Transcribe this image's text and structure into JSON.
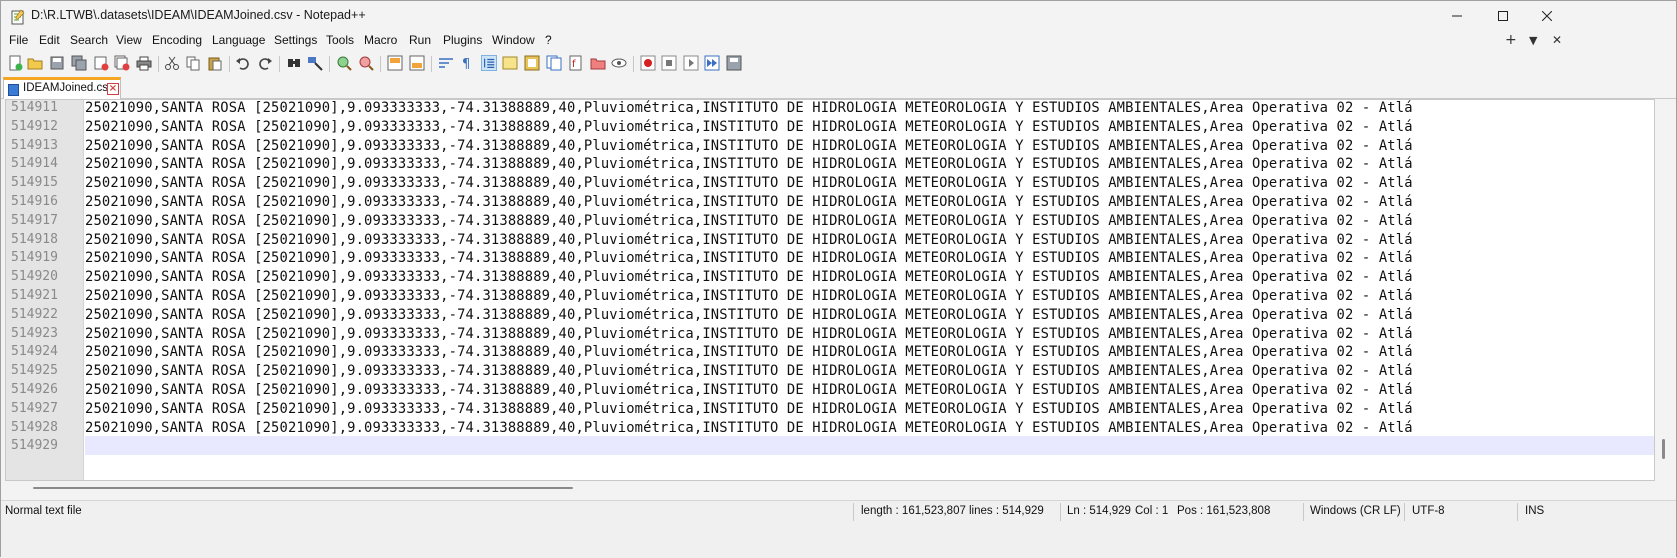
{
  "window": {
    "title": "D:\\R.LTWB\\.datasets\\IDEAM\\IDEAMJoined.csv - Notepad++"
  },
  "menu": [
    "File",
    "Edit",
    "Search",
    "View",
    "Encoding",
    "Language",
    "Settings",
    "Tools",
    "Macro",
    "Run",
    "Plugins",
    "Window",
    "?"
  ],
  "menu_right": {
    "plus": "+",
    "down": "▼",
    "close": "✕"
  },
  "tab": {
    "label": "IDEAMJoined.csv"
  },
  "editor": {
    "lines": [
      {
        "num": "514911",
        "text": "25021090,SANTA ROSA [25021090],9.093333333,-74.31388889,40,Pluviométrica,INSTITUTO DE HIDROLOGIA METEOROLOGIA Y ESTUDIOS AMBIENTALES,Area Operativa 02 - Atlá"
      },
      {
        "num": "514912",
        "text": "25021090,SANTA ROSA [25021090],9.093333333,-74.31388889,40,Pluviométrica,INSTITUTO DE HIDROLOGIA METEOROLOGIA Y ESTUDIOS AMBIENTALES,Area Operativa 02 - Atlá"
      },
      {
        "num": "514913",
        "text": "25021090,SANTA ROSA [25021090],9.093333333,-74.31388889,40,Pluviométrica,INSTITUTO DE HIDROLOGIA METEOROLOGIA Y ESTUDIOS AMBIENTALES,Area Operativa 02 - Atlá"
      },
      {
        "num": "514914",
        "text": "25021090,SANTA ROSA [25021090],9.093333333,-74.31388889,40,Pluviométrica,INSTITUTO DE HIDROLOGIA METEOROLOGIA Y ESTUDIOS AMBIENTALES,Area Operativa 02 - Atlá"
      },
      {
        "num": "514915",
        "text": "25021090,SANTA ROSA [25021090],9.093333333,-74.31388889,40,Pluviométrica,INSTITUTO DE HIDROLOGIA METEOROLOGIA Y ESTUDIOS AMBIENTALES,Area Operativa 02 - Atlá"
      },
      {
        "num": "514916",
        "text": "25021090,SANTA ROSA [25021090],9.093333333,-74.31388889,40,Pluviométrica,INSTITUTO DE HIDROLOGIA METEOROLOGIA Y ESTUDIOS AMBIENTALES,Area Operativa 02 - Atlá"
      },
      {
        "num": "514917",
        "text": "25021090,SANTA ROSA [25021090],9.093333333,-74.31388889,40,Pluviométrica,INSTITUTO DE HIDROLOGIA METEOROLOGIA Y ESTUDIOS AMBIENTALES,Area Operativa 02 - Atlá"
      },
      {
        "num": "514918",
        "text": "25021090,SANTA ROSA [25021090],9.093333333,-74.31388889,40,Pluviométrica,INSTITUTO DE HIDROLOGIA METEOROLOGIA Y ESTUDIOS AMBIENTALES,Area Operativa 02 - Atlá"
      },
      {
        "num": "514919",
        "text": "25021090,SANTA ROSA [25021090],9.093333333,-74.31388889,40,Pluviométrica,INSTITUTO DE HIDROLOGIA METEOROLOGIA Y ESTUDIOS AMBIENTALES,Area Operativa 02 - Atlá"
      },
      {
        "num": "514920",
        "text": "25021090,SANTA ROSA [25021090],9.093333333,-74.31388889,40,Pluviométrica,INSTITUTO DE HIDROLOGIA METEOROLOGIA Y ESTUDIOS AMBIENTALES,Area Operativa 02 - Atlá"
      },
      {
        "num": "514921",
        "text": "25021090,SANTA ROSA [25021090],9.093333333,-74.31388889,40,Pluviométrica,INSTITUTO DE HIDROLOGIA METEOROLOGIA Y ESTUDIOS AMBIENTALES,Area Operativa 02 - Atlá"
      },
      {
        "num": "514922",
        "text": "25021090,SANTA ROSA [25021090],9.093333333,-74.31388889,40,Pluviométrica,INSTITUTO DE HIDROLOGIA METEOROLOGIA Y ESTUDIOS AMBIENTALES,Area Operativa 02 - Atlá"
      },
      {
        "num": "514923",
        "text": "25021090,SANTA ROSA [25021090],9.093333333,-74.31388889,40,Pluviométrica,INSTITUTO DE HIDROLOGIA METEOROLOGIA Y ESTUDIOS AMBIENTALES,Area Operativa 02 - Atlá"
      },
      {
        "num": "514924",
        "text": "25021090,SANTA ROSA [25021090],9.093333333,-74.31388889,40,Pluviométrica,INSTITUTO DE HIDROLOGIA METEOROLOGIA Y ESTUDIOS AMBIENTALES,Area Operativa 02 - Atlá"
      },
      {
        "num": "514925",
        "text": "25021090,SANTA ROSA [25021090],9.093333333,-74.31388889,40,Pluviométrica,INSTITUTO DE HIDROLOGIA METEOROLOGIA Y ESTUDIOS AMBIENTALES,Area Operativa 02 - Atlá"
      },
      {
        "num": "514926",
        "text": "25021090,SANTA ROSA [25021090],9.093333333,-74.31388889,40,Pluviométrica,INSTITUTO DE HIDROLOGIA METEOROLOGIA Y ESTUDIOS AMBIENTALES,Area Operativa 02 - Atlá"
      },
      {
        "num": "514927",
        "text": "25021090,SANTA ROSA [25021090],9.093333333,-74.31388889,40,Pluviométrica,INSTITUTO DE HIDROLOGIA METEOROLOGIA Y ESTUDIOS AMBIENTALES,Area Operativa 02 - Atlá"
      },
      {
        "num": "514928",
        "text": "25021090,SANTA ROSA [25021090],9.093333333,-74.31388889,40,Pluviométrica,INSTITUTO DE HIDROLOGIA METEOROLOGIA Y ESTUDIOS AMBIENTALES,Area Operativa 02 - Atlá"
      },
      {
        "num": "514929",
        "text": ""
      }
    ]
  },
  "status": {
    "file_type": "Normal text file",
    "length": "length : 161,523,807",
    "lines": "lines : 514,929",
    "ln": "Ln : 514,929",
    "col": "Col : 1",
    "pos": "Pos : 161,523,808",
    "eol": "Windows (CR LF)",
    "encoding": "UTF-8",
    "mode": "INS"
  },
  "colors": {
    "current_line": "#e8e8ff",
    "tab_accent": "#f5a623",
    "gutter": "#e4e4e4"
  }
}
